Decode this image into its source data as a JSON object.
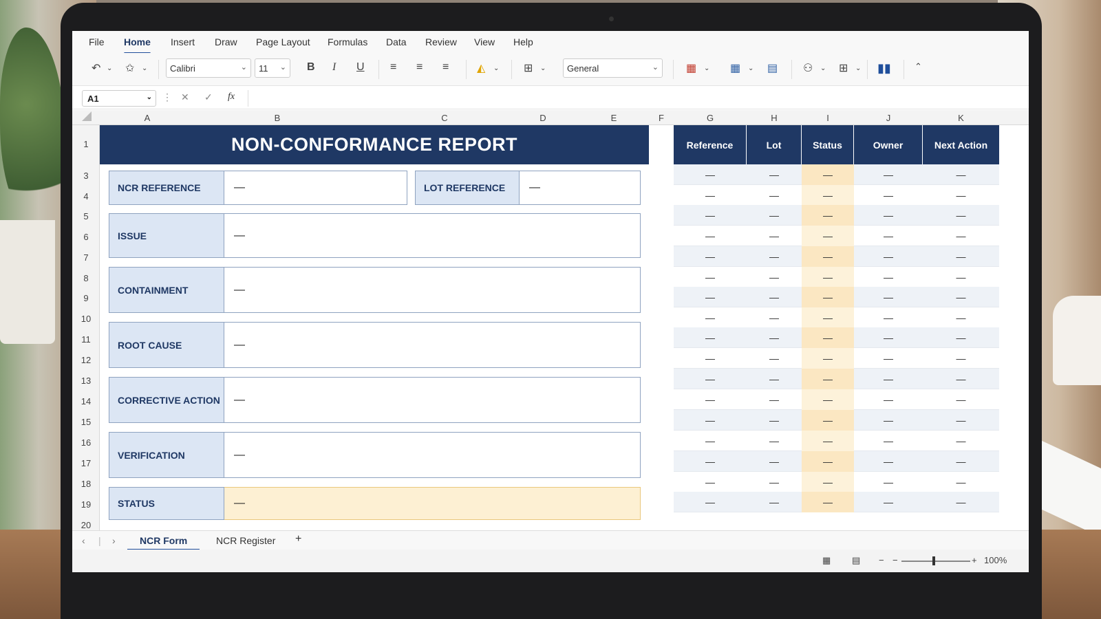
{
  "menu": [
    "File",
    "Home",
    "Insert",
    "Draw",
    "Page Layout",
    "Formulas",
    "Data",
    "Review",
    "View",
    "Help"
  ],
  "active_menu": "Home",
  "ribbon": {
    "font": "Calibri",
    "font_size": "11",
    "number_format": "General",
    "bold": "B",
    "italic": "I",
    "underline": "U"
  },
  "formula_bar": {
    "cell": "A1",
    "cancel": "✕",
    "enter": "✓",
    "fx": "fx",
    "value": ""
  },
  "columns": [
    "A",
    "B",
    "C",
    "D",
    "E",
    "F",
    "G",
    "H",
    "I",
    "J",
    "K"
  ],
  "rows": [
    "1",
    "3",
    "4",
    "5",
    "6",
    "7",
    "8",
    "9",
    "10",
    "11",
    "12",
    "13",
    "14",
    "15",
    "16",
    "17",
    "18",
    "19",
    "20"
  ],
  "form": {
    "title": "NON-CONFORMANCE REPORT",
    "ncr_label": "NCR REFERENCE",
    "ncr_value": "—",
    "lot_label": "LOT REFERENCE",
    "lot_value": "—",
    "fields": [
      {
        "label": "ISSUE",
        "value": "—"
      },
      {
        "label": "CONTAINMENT",
        "value": "—"
      },
      {
        "label": "ROOT CAUSE",
        "value": "—"
      },
      {
        "label": "CORRECTIVE ACTION",
        "value": "—"
      },
      {
        "label": "VERIFICATION",
        "value": "—"
      },
      {
        "label": "STATUS",
        "value": "—"
      }
    ]
  },
  "register": {
    "headers": [
      "Reference",
      "Lot",
      "Status",
      "Owner",
      "Next Action"
    ],
    "rows": [
      [
        "—",
        "—",
        "—",
        "—",
        "—"
      ],
      [
        "—",
        "—",
        "—",
        "—",
        "—"
      ],
      [
        "—",
        "—",
        "—",
        "—",
        "—"
      ],
      [
        "—",
        "—",
        "—",
        "—",
        "—"
      ],
      [
        "—",
        "—",
        "—",
        "—",
        "—"
      ],
      [
        "—",
        "—",
        "—",
        "—",
        "—"
      ],
      [
        "—",
        "—",
        "—",
        "—",
        "—"
      ],
      [
        "—",
        "—",
        "—",
        "—",
        "—"
      ],
      [
        "—",
        "—",
        "—",
        "—",
        "—"
      ],
      [
        "—",
        "—",
        "—",
        "—",
        "—"
      ],
      [
        "—",
        "—",
        "—",
        "—",
        "—"
      ],
      [
        "—",
        "—",
        "—",
        "—",
        "—"
      ],
      [
        "—",
        "—",
        "—",
        "—",
        "—"
      ],
      [
        "—",
        "—",
        "—",
        "—",
        "—"
      ],
      [
        "—",
        "—",
        "—",
        "—",
        "—"
      ],
      [
        "—",
        "—",
        "—",
        "—",
        "—"
      ],
      [
        "—",
        "—",
        "—",
        "—",
        "—"
      ]
    ]
  },
  "sheets": [
    "NCR Form",
    "NCR Register"
  ],
  "active_sheet": "NCR Form",
  "add_sheet": "+",
  "zoom": "100%",
  "colors": {
    "header_navy": "#1f3864",
    "label_blue": "#dce6f4",
    "status_amber": "#fdf0d3"
  }
}
